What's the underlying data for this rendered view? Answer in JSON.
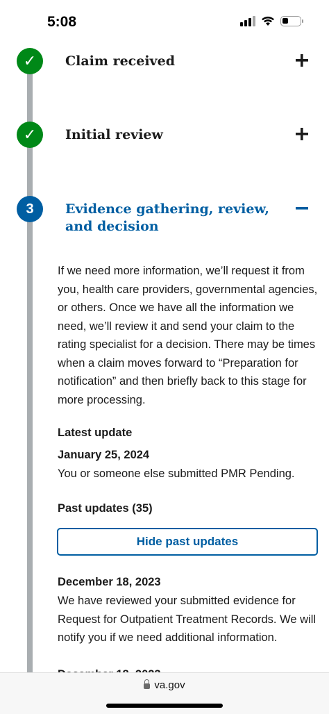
{
  "status_bar": {
    "time": "5:08"
  },
  "steps": [
    {
      "title": "Claim received",
      "state": "complete",
      "toggle": "expand"
    },
    {
      "title": "Initial review",
      "state": "complete",
      "toggle": "expand"
    },
    {
      "number": "3",
      "title": "Evidence gathering, review, and decision",
      "state": "current",
      "toggle": "collapse"
    }
  ],
  "description": "If we need more information, we’ll request it from you, health care providers, governmental agencies, or others. Once we have all the information we need, we’ll review it and send your claim to the rating specialist for a decision. There may be times when a claim moves forward to “Preparation for notification” and then briefly back to this stage for more processing.",
  "latest_update": {
    "heading": "Latest update",
    "date": "January 25, 2024",
    "text": "You or someone else submitted PMR Pending."
  },
  "past_updates": {
    "heading": "Past updates (35)",
    "button_label": "Hide past updates",
    "items": [
      {
        "date": "December 18, 2023",
        "text": "We have reviewed your submitted evidence for Request for Outpatient Treatment Records. We will notify you if we need additional information."
      },
      {
        "date": "December 18, 2023",
        "text": ""
      }
    ]
  },
  "browser": {
    "url": "va.gov"
  },
  "colors": {
    "success": "#008817",
    "primary": "#005ea2",
    "timeline": "#a9aeb1"
  }
}
